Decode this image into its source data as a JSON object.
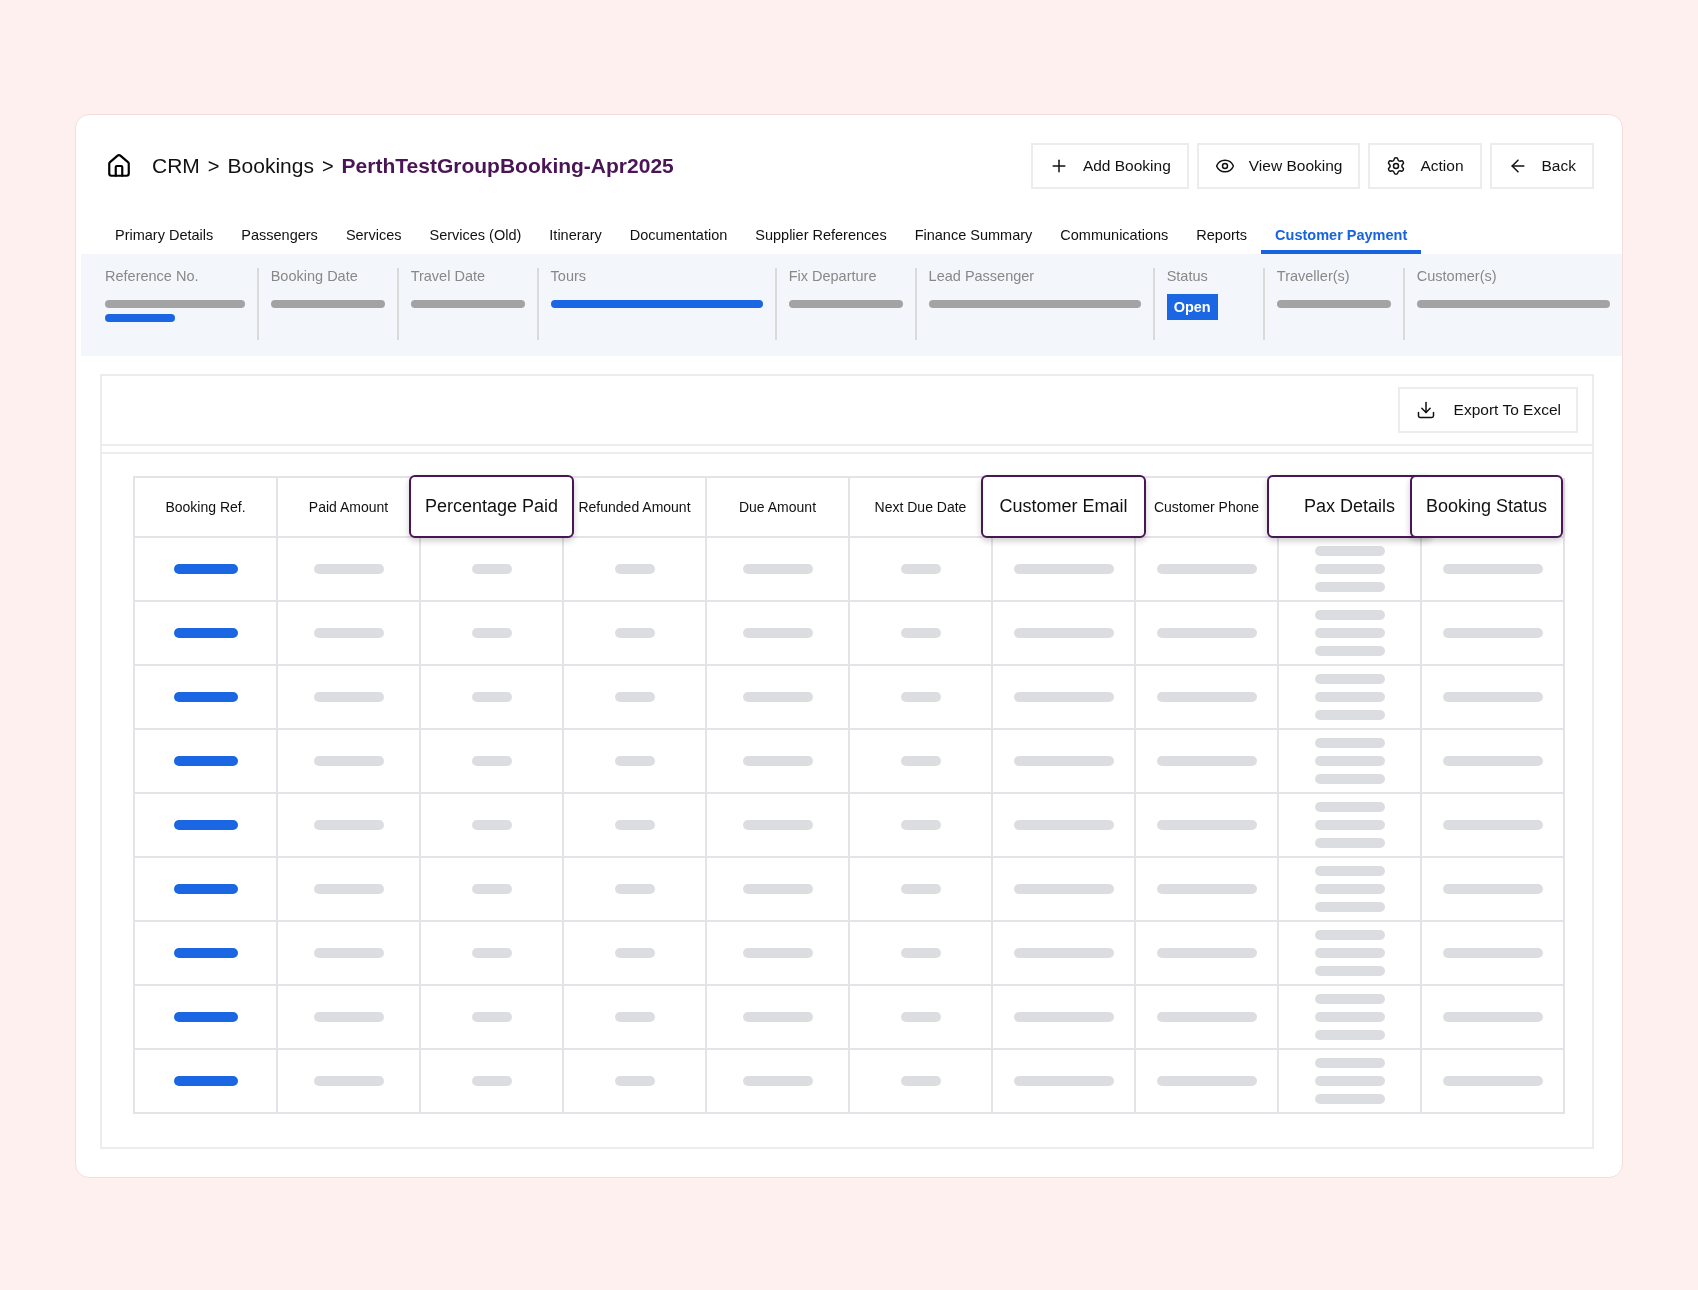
{
  "breadcrumb": [
    {
      "kind": "crumb",
      "label": "CRM",
      "current": false
    },
    {
      "kind": "separator",
      "label": ">"
    },
    {
      "kind": "crumb",
      "label": "Bookings",
      "current": false
    },
    {
      "kind": "separator",
      "label": ">"
    },
    {
      "kind": "crumb",
      "label": "PerthTestGroupBooking-Apr2025",
      "current": true
    }
  ],
  "actions": [
    {
      "label": "Add Booking"
    },
    {
      "label": "View Booking"
    },
    {
      "label": "Action"
    },
    {
      "label": "Back"
    }
  ],
  "tabs": [
    {
      "label": "Primary Details",
      "selected": false
    },
    {
      "label": "Passengers",
      "selected": false
    },
    {
      "label": "Services",
      "selected": false
    },
    {
      "label": "Services (Old)",
      "selected": false
    },
    {
      "label": "Itinerary",
      "selected": false
    },
    {
      "label": "Documentation",
      "selected": false
    },
    {
      "label": "Supplier References",
      "selected": false
    },
    {
      "label": "Finance Summary",
      "selected": false
    },
    {
      "label": "Communications",
      "selected": false
    },
    {
      "label": "Reports",
      "selected": false
    },
    {
      "label": "Customer Payment",
      "selected": true
    }
  ],
  "summary": [
    {
      "label": "Reference No.",
      "kind": "text-link"
    },
    {
      "label": "Booking Date",
      "kind": "text"
    },
    {
      "label": "Travel Date",
      "kind": "text"
    },
    {
      "label": "Tours",
      "kind": "link"
    },
    {
      "label": "Fix Departure",
      "kind": "text"
    },
    {
      "label": "Lead Passenger",
      "kind": "text"
    },
    {
      "label": "Status",
      "kind": "badge",
      "value": "Open"
    },
    {
      "label": "Traveller(s)",
      "kind": "text"
    },
    {
      "label": "Customer(s)",
      "kind": "text"
    }
  ],
  "export_button": {
    "label": "Export To Excel"
  },
  "table": {
    "columns": [
      {
        "label": "Booking Ref.",
        "highlighted": false,
        "kind": "link"
      },
      {
        "label": "Paid Amount",
        "highlighted": false,
        "kind": "medium"
      },
      {
        "label": "Percentage Paid",
        "highlighted": true,
        "kind": "short"
      },
      {
        "label": "Refunded Amount",
        "highlighted": false,
        "kind": "short"
      },
      {
        "label": "Due Amount",
        "highlighted": false,
        "kind": "medium"
      },
      {
        "label": "Next Due Date",
        "highlighted": false,
        "kind": "short"
      },
      {
        "label": "Customer Email",
        "highlighted": true,
        "kind": "long"
      },
      {
        "label": "Customer Phone",
        "highlighted": false,
        "kind": "long"
      },
      {
        "label": "Pax Details",
        "highlighted": true,
        "kind": "multi"
      },
      {
        "label": "Booking Status",
        "highlighted": true,
        "kind": "long"
      }
    ],
    "rows": [
      {
        "kind": "placeholder"
      },
      {
        "kind": "placeholder"
      },
      {
        "kind": "placeholder"
      },
      {
        "kind": "placeholder"
      },
      {
        "kind": "placeholder"
      },
      {
        "kind": "placeholder"
      },
      {
        "kind": "placeholder"
      },
      {
        "kind": "placeholder"
      },
      {
        "kind": "placeholder"
      }
    ]
  }
}
